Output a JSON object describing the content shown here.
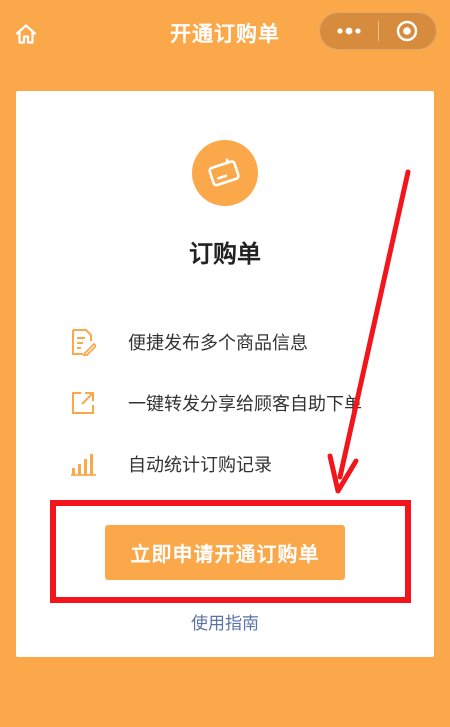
{
  "header": {
    "title": "开通订购单",
    "home_icon": "home-icon",
    "more_icon": "more-dots-icon",
    "close_icon": "target-close-icon"
  },
  "card": {
    "title": "订购单",
    "badge_icon": "order-form-icon",
    "features": [
      {
        "icon": "edit-document-icon",
        "label": "便捷发布多个商品信息"
      },
      {
        "icon": "share-external-icon",
        "label": "一键转发分享给顾客自助下单"
      },
      {
        "icon": "bar-chart-icon",
        "label": "自动统计订购记录"
      }
    ],
    "primary_button": "立即申请开通订购单",
    "guide_link": "使用指南"
  },
  "colors": {
    "background": "#FBA84B",
    "accent": "#FBA84B",
    "link": "#5B73A8",
    "annotation": "#F2161C"
  }
}
